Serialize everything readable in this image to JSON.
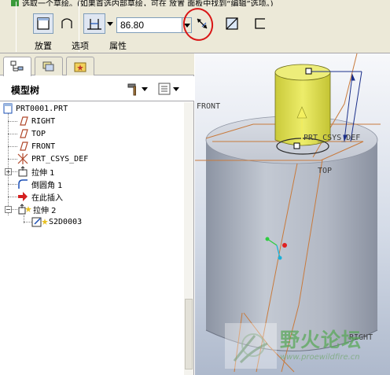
{
  "dashboard": {
    "message": "选取一个草绘。(如果首选内部草绘，可在 放置 面板中找到“编辑”选项。)",
    "depth_value": "86.80",
    "tabs": {
      "placement": "放置",
      "options": "选项",
      "properties": "属性"
    },
    "icons": {
      "solid": "solid-extrude-icon",
      "surface": "surface-extrude-icon",
      "depth": "depth-blind-icon",
      "flip": "flip-direction-icon",
      "remove": "remove-material-icon",
      "thicken": "thicken-sketch-icon"
    },
    "highlight_color": "#d91616"
  },
  "panel": {
    "tabs": [
      "model-tree-tab",
      "layer-tab",
      "favorites-tab"
    ],
    "title": "模型树"
  },
  "tree": {
    "root": "PRT0001.PRT",
    "items": [
      {
        "label": "RIGHT",
        "icon": "datum-plane-icon"
      },
      {
        "label": "TOP",
        "icon": "datum-plane-icon"
      },
      {
        "label": "FRONT",
        "icon": "datum-plane-icon"
      },
      {
        "label": "PRT_CSYS_DEF",
        "icon": "csys-icon"
      },
      {
        "label": "拉伸 1",
        "icon": "extrude-icon"
      },
      {
        "label": "倒圆角 1",
        "icon": "round-icon"
      },
      {
        "label": "在此插入",
        "icon": "insert-here-arrow-icon"
      },
      {
        "label": "拉伸 2",
        "icon": "extrude-icon"
      },
      {
        "label": "S2D0003",
        "icon": "sketch-icon"
      }
    ]
  },
  "viewport": {
    "labels": {
      "front": "FRONT",
      "csys": "PRT_CSYS_DEF",
      "top": "TOP",
      "right": "RIGHT"
    },
    "watermark": {
      "cn": "野火论坛",
      "url": "www.proewildfire.cn"
    },
    "colors": {
      "body": "#b9bfcb",
      "preview": "#e6e65a",
      "edge": "#c87a3c"
    }
  }
}
